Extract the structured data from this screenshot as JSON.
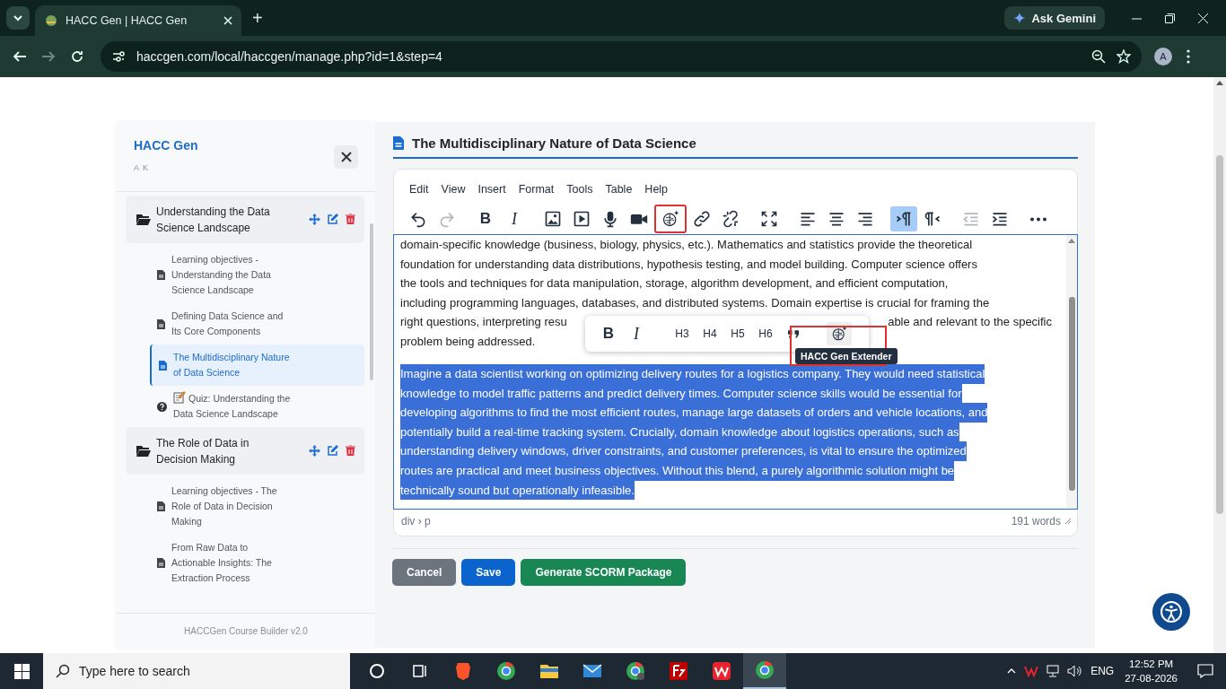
{
  "browser": {
    "tab_title": "HACC Gen | HACC Gen",
    "new_tab": "+",
    "gemini": "Ask Gemini",
    "url": "haccgen.com/local/haccgen/manage.php?id=1&step=4",
    "profile": "A"
  },
  "sidebar": {
    "title": "HACC Gen",
    "subtitle": "A K",
    "sections": [
      {
        "title": "Understanding the Data Science Landscape",
        "items": [
          {
            "kind": "page",
            "label": "Learning objectives - Understanding the Data Science Landscape",
            "selected": false
          },
          {
            "kind": "page",
            "label": "Defining Data Science and Its Core Components",
            "selected": false
          },
          {
            "kind": "page",
            "label": "The Multidisciplinary Nature of Data Science",
            "selected": true
          },
          {
            "kind": "quiz",
            "label": "Quiz: Understanding the Data Science Landscape",
            "selected": false
          }
        ]
      },
      {
        "title": "The Role of Data in Decision Making",
        "items": [
          {
            "kind": "page",
            "label": "Learning objectives - The Role of Data in Decision Making",
            "selected": false
          },
          {
            "kind": "page",
            "label": "From Raw Data to Actionable Insights: The Extraction Process",
            "selected": false
          }
        ]
      }
    ],
    "footer": "HACCGen Course Builder v2.0"
  },
  "page_title": "The Multidisciplinary Nature of Data Science",
  "editor": {
    "menu": [
      "Edit",
      "View",
      "Insert",
      "Format",
      "Tools",
      "Table",
      "Help"
    ],
    "toolbar": [
      {
        "kind": "undo",
        "disabled": false,
        "active": false,
        "highlighted": false
      },
      {
        "kind": "redo",
        "disabled": true,
        "active": false,
        "highlighted": false
      },
      {
        "kind": "bold",
        "label": "B",
        "disabled": false,
        "active": false,
        "highlighted": false
      },
      {
        "kind": "italic",
        "label": "I",
        "disabled": false,
        "active": false,
        "highlighted": false
      },
      {
        "kind": "image",
        "disabled": false,
        "active": false,
        "highlighted": false
      },
      {
        "kind": "media",
        "disabled": false,
        "active": false,
        "highlighted": false
      },
      {
        "kind": "mic",
        "disabled": false,
        "active": false,
        "highlighted": false
      },
      {
        "kind": "video",
        "disabled": false,
        "active": false,
        "highlighted": false
      },
      {
        "kind": "brain",
        "disabled": false,
        "active": false,
        "highlighted": true
      },
      {
        "kind": "link",
        "disabled": false,
        "active": false,
        "highlighted": false
      },
      {
        "kind": "unlink",
        "disabled": false,
        "active": false,
        "highlighted": false
      },
      {
        "kind": "fullscreen",
        "disabled": false,
        "active": false,
        "highlighted": false
      },
      {
        "kind": "align-left",
        "disabled": false,
        "active": false,
        "highlighted": false
      },
      {
        "kind": "align-center",
        "disabled": false,
        "active": false,
        "highlighted": false
      },
      {
        "kind": "align-right",
        "disabled": false,
        "active": false,
        "highlighted": false
      },
      {
        "kind": "ltr",
        "disabled": false,
        "active": true,
        "highlighted": false
      },
      {
        "kind": "rtl",
        "disabled": false,
        "active": false,
        "highlighted": false
      },
      {
        "kind": "outdent",
        "disabled": true,
        "active": false,
        "highlighted": false
      },
      {
        "kind": "indent",
        "disabled": false,
        "active": false,
        "highlighted": false
      },
      {
        "kind": "more",
        "disabled": false,
        "active": false,
        "highlighted": false
      }
    ],
    "paragraphs": [
      {
        "selected": false,
        "lines": [
          "domain-specific knowledge (business, biology, physics, etc.). Mathematics and statistics provide the theoretical",
          "foundation for understanding data distributions, hypothesis testing, and model building. Computer science offers",
          "the tools and techniques for data manipulation, storage, algorithm development, and efficient computation,",
          "including programming languages, databases, and distributed systems. Domain expertise is crucial for framing the",
          [
            "right questions, interpreting resu",
            "able and relevant to the specific"
          ],
          "problem being addressed."
        ]
      },
      {
        "selected": true,
        "lines": [
          "Imagine a data scientist working on optimizing delivery routes for a logistics company. They would need statistical",
          "knowledge to model traffic patterns and predict delivery times. Computer science skills would be essential for",
          "developing algorithms to find the most efficient routes, manage large datasets of orders and vehicle locations, and",
          "potentially build a real-time tracking system. Crucially, domain knowledge about logistics operations, such as",
          "understanding delivery windows, driver constraints, and customer preferences, is vital to ensure the optimized",
          "routes are practical and meet business objectives. Without this blend, a purely algorithmic solution might be",
          "technically sound but operationally infeasible."
        ]
      }
    ],
    "floating_toolbar": {
      "items": [
        {
          "kind": "bold",
          "label": "B"
        },
        {
          "kind": "italic",
          "label": "I"
        },
        {
          "kind": "heading",
          "label": "H3"
        },
        {
          "kind": "heading",
          "label": "H4"
        },
        {
          "kind": "heading",
          "label": "H5"
        },
        {
          "kind": "heading",
          "label": "H6"
        },
        {
          "kind": "quote"
        },
        {
          "kind": "brain"
        }
      ],
      "extender_highlighted": true,
      "tooltip": "HACC Gen Extender"
    },
    "path": "div › p",
    "word_count": "191 words"
  },
  "buttons": [
    {
      "kind": "secondary",
      "label": "Cancel"
    },
    {
      "kind": "primary",
      "label": "Save"
    },
    {
      "kind": "success",
      "label": "Generate SCORM Package"
    }
  ],
  "taskbar": {
    "search_placeholder": "Type here to search",
    "language": "ENG",
    "time": "12:52 PM",
    "date": "27-08-2026"
  }
}
